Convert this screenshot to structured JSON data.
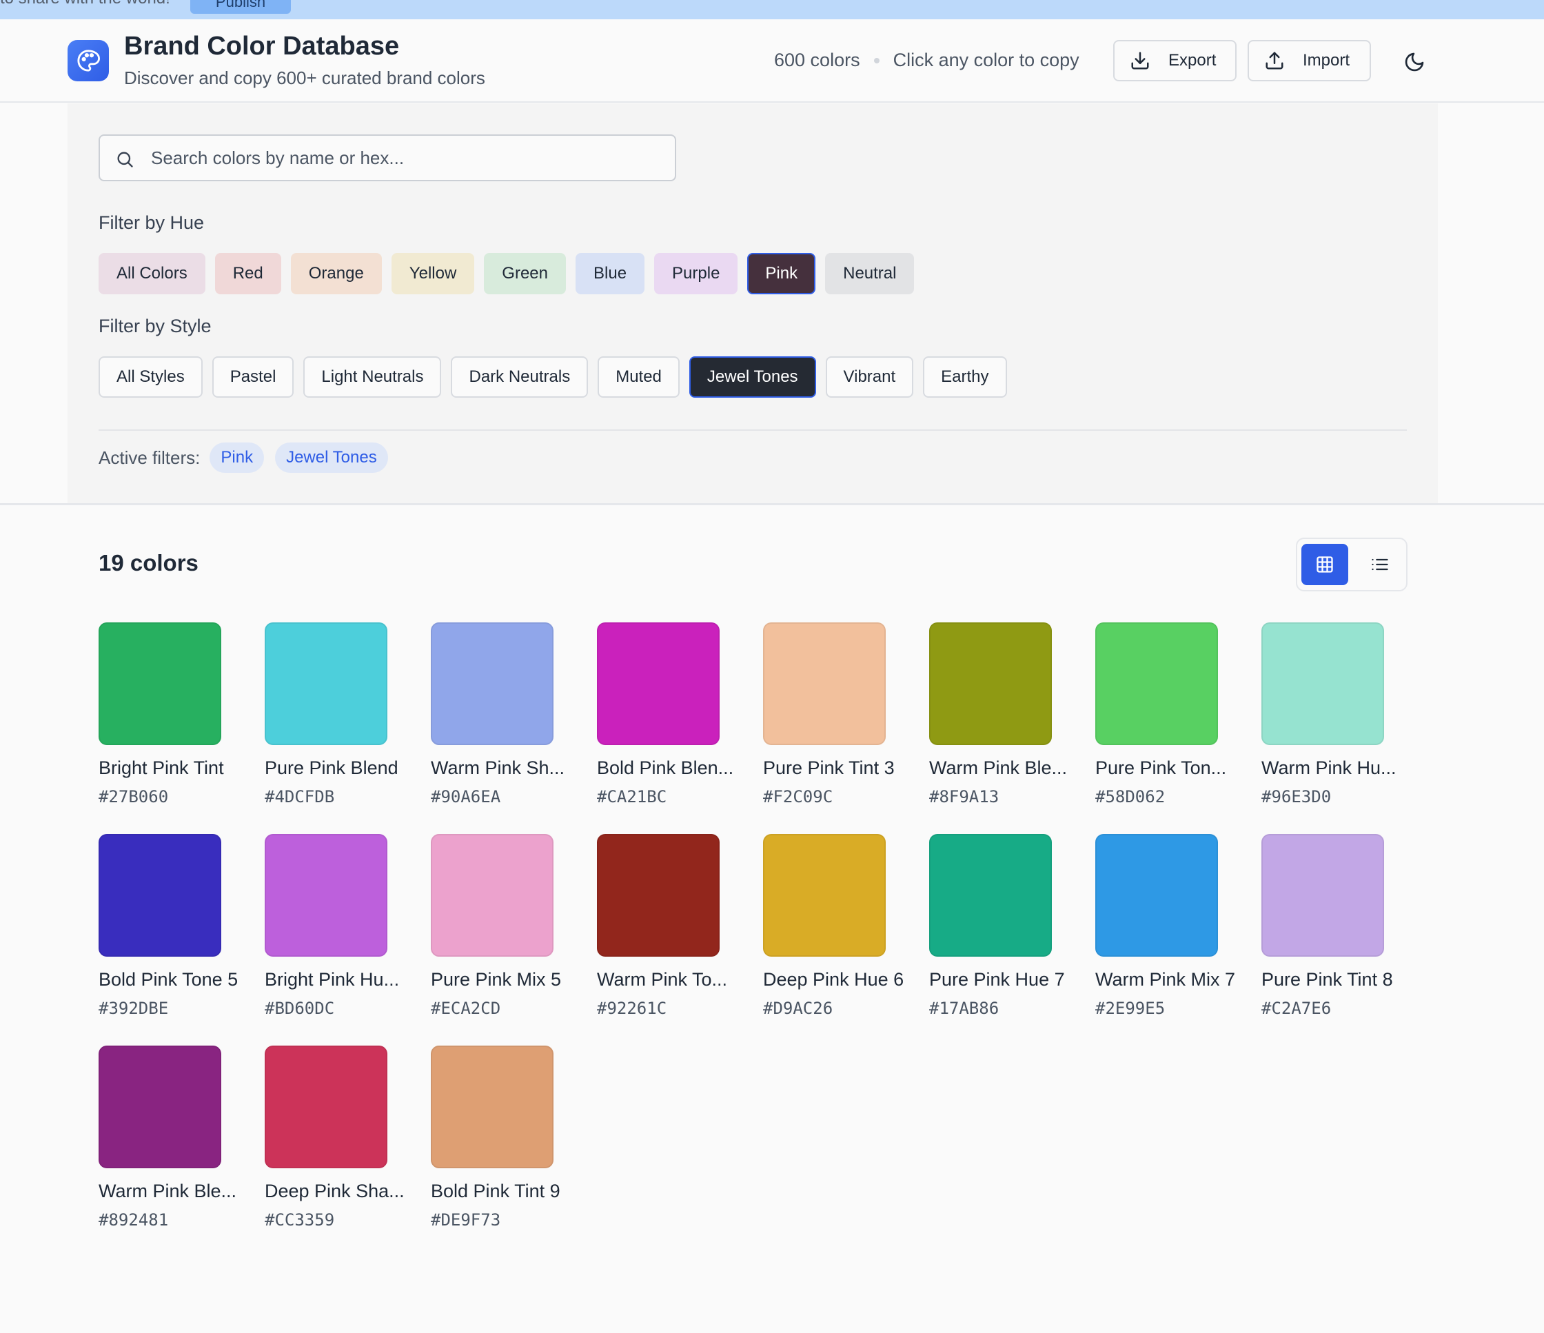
{
  "banner": {
    "text": "to share with the world!",
    "button_label": "Publish"
  },
  "header": {
    "title": "Brand Color Database",
    "subtitle": "Discover and copy 600+ curated brand colors",
    "count": "600 colors",
    "hint": "Click any color to copy",
    "export_label": "Export",
    "import_label": "Import"
  },
  "search": {
    "placeholder": "Search colors by name or hex..."
  },
  "hue_filter": {
    "label": "Filter by Hue",
    "options": [
      {
        "label": "All Colors",
        "bg": "#ebdde6",
        "active": false
      },
      {
        "label": "Red",
        "bg": "#f0d8d8",
        "active": false
      },
      {
        "label": "Orange",
        "bg": "#f3e0d3",
        "active": false
      },
      {
        "label": "Yellow",
        "bg": "#f1ead2",
        "active": false
      },
      {
        "label": "Green",
        "bg": "#d8ebdc",
        "active": false
      },
      {
        "label": "Blue",
        "bg": "#d8e1f5",
        "active": false
      },
      {
        "label": "Purple",
        "bg": "#ead9f2",
        "active": false
      },
      {
        "label": "Pink",
        "bg": "#45303d",
        "active": true
      },
      {
        "label": "Neutral",
        "bg": "#e2e3e5",
        "active": false
      }
    ]
  },
  "style_filter": {
    "label": "Filter by Style",
    "options": [
      {
        "label": "All Styles",
        "active": false
      },
      {
        "label": "Pastel",
        "active": false
      },
      {
        "label": "Light Neutrals",
        "active": false
      },
      {
        "label": "Dark Neutrals",
        "active": false
      },
      {
        "label": "Muted",
        "active": false
      },
      {
        "label": "Jewel Tones",
        "active": true
      },
      {
        "label": "Vibrant",
        "active": false
      },
      {
        "label": "Earthy",
        "active": false
      }
    ]
  },
  "active_filters": {
    "label": "Active filters:",
    "tags": [
      "Pink",
      "Jewel Tones"
    ]
  },
  "results": {
    "count_label": "19 colors",
    "colors": [
      {
        "name": "Bright Pink Tint",
        "hex": "#27B060"
      },
      {
        "name": "Pure Pink Blend",
        "hex": "#4DCFDB"
      },
      {
        "name": "Warm Pink Sh...",
        "hex": "#90A6EA"
      },
      {
        "name": "Bold Pink Blen...",
        "hex": "#CA21BC"
      },
      {
        "name": "Pure Pink Tint 3",
        "hex": "#F2C09C"
      },
      {
        "name": "Warm Pink Ble...",
        "hex": "#8F9A13"
      },
      {
        "name": "Pure Pink Ton...",
        "hex": "#58D062"
      },
      {
        "name": "Warm Pink Hu...",
        "hex": "#96E3D0"
      },
      {
        "name": "Bold Pink Tone 5",
        "hex": "#392DBE"
      },
      {
        "name": "Bright Pink Hu...",
        "hex": "#BD60DC"
      },
      {
        "name": "Pure Pink Mix 5",
        "hex": "#ECA2CD"
      },
      {
        "name": "Warm Pink To...",
        "hex": "#92261C"
      },
      {
        "name": "Deep Pink Hue 6",
        "hex": "#D9AC26"
      },
      {
        "name": "Pure Pink Hue 7",
        "hex": "#17AB86"
      },
      {
        "name": "Warm Pink Mix 7",
        "hex": "#2E99E5"
      },
      {
        "name": "Pure Pink Tint 8",
        "hex": "#C2A7E6"
      },
      {
        "name": "Warm Pink Ble...",
        "hex": "#892481"
      },
      {
        "name": "Deep Pink Sha...",
        "hex": "#CC3359"
      },
      {
        "name": "Bold Pink Tint 9",
        "hex": "#DE9F73"
      }
    ]
  }
}
